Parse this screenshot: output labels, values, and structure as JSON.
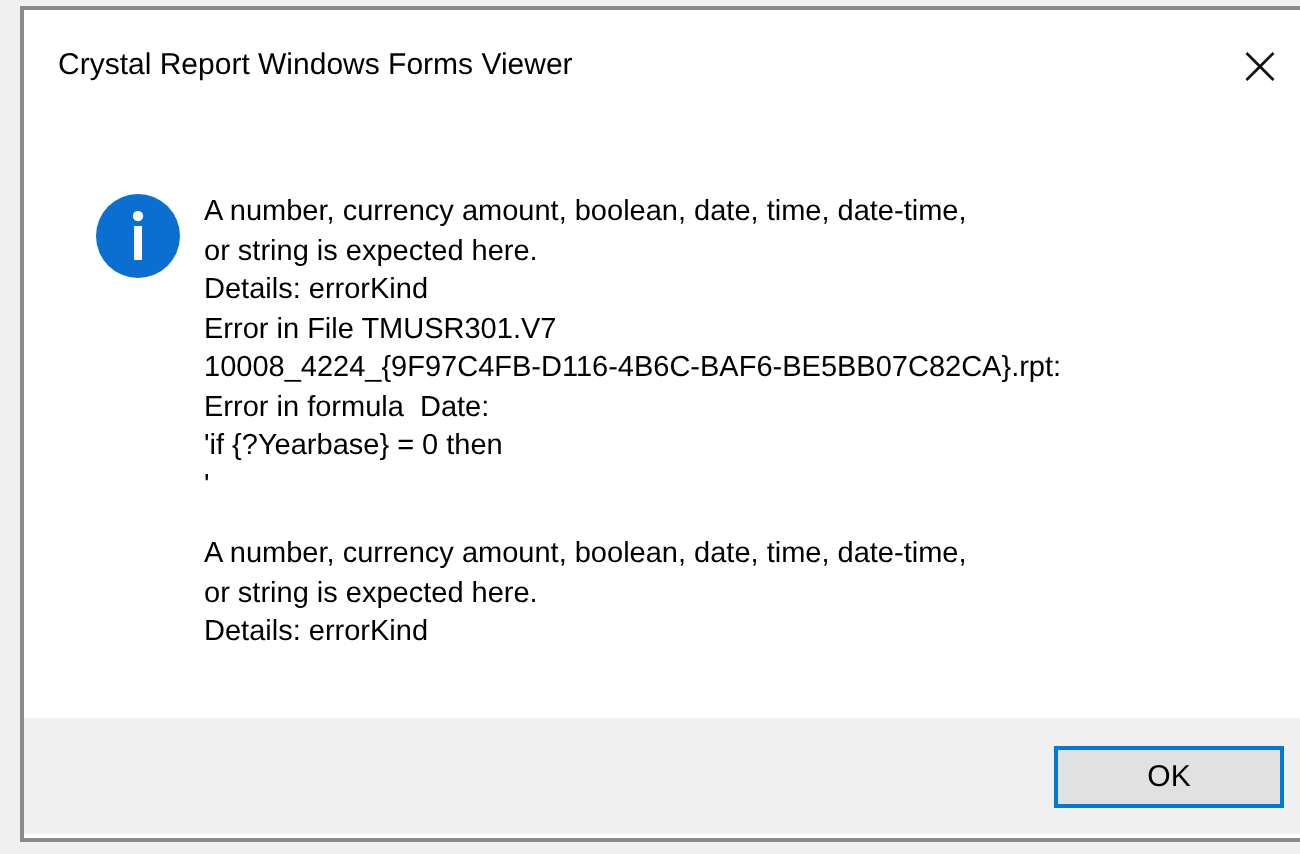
{
  "window": {
    "title": "Crystal Report Windows Forms Viewer",
    "close": "×"
  },
  "message": {
    "paragraphs": [
      [
        "A number, currency amount, boolean, date, time, date-time,",
        "or string is expected here.",
        "Details: errorKind",
        "Error in File TMUSR301.V7",
        "10008_4224_{9F97C4FB-D116-4B6C-BAF6-BE5BB07C82CA}.rpt:",
        "Error in formula  Date:",
        "'if {?Yearbase} = 0 then",
        "'"
      ],
      [
        "A number, currency amount, boolean, date, time, date-time,",
        "or string is expected here.",
        "Details: errorKind"
      ]
    ]
  },
  "buttons": [
    {
      "label": "OK",
      "selected": true
    }
  ]
}
